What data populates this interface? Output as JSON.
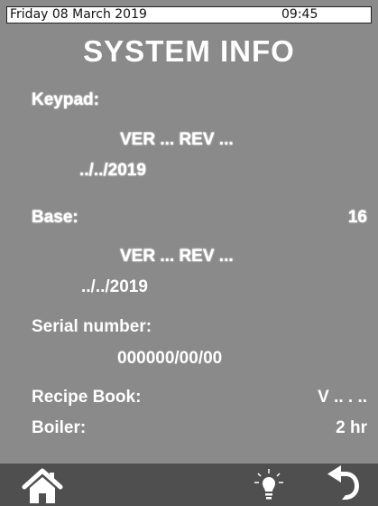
{
  "status_bar": {
    "date": "Friday 08 March 2019",
    "time": "09:45"
  },
  "page": {
    "title": "SYSTEM INFO"
  },
  "keypad": {
    "label": "Keypad:",
    "version": "VER ... REV ...",
    "date": "../../2019"
  },
  "base": {
    "label": "Base:",
    "value": "16",
    "version": "VER ... REV ...",
    "date": "../../2019"
  },
  "serial": {
    "label": "Serial number:",
    "value": "000000/00/00"
  },
  "recipe_book": {
    "label": "Recipe Book:",
    "value": "V .. . .."
  },
  "boiler": {
    "label": "Boiler:",
    "value": "2 hr"
  },
  "nav": {
    "icons": [
      "home-icon",
      "light-bulb-icon",
      "back-arrow-icon"
    ]
  },
  "colors": {
    "screen_background": "#8a8a8a",
    "nav_background": "#4f4f4f",
    "text": "#ffffff"
  }
}
